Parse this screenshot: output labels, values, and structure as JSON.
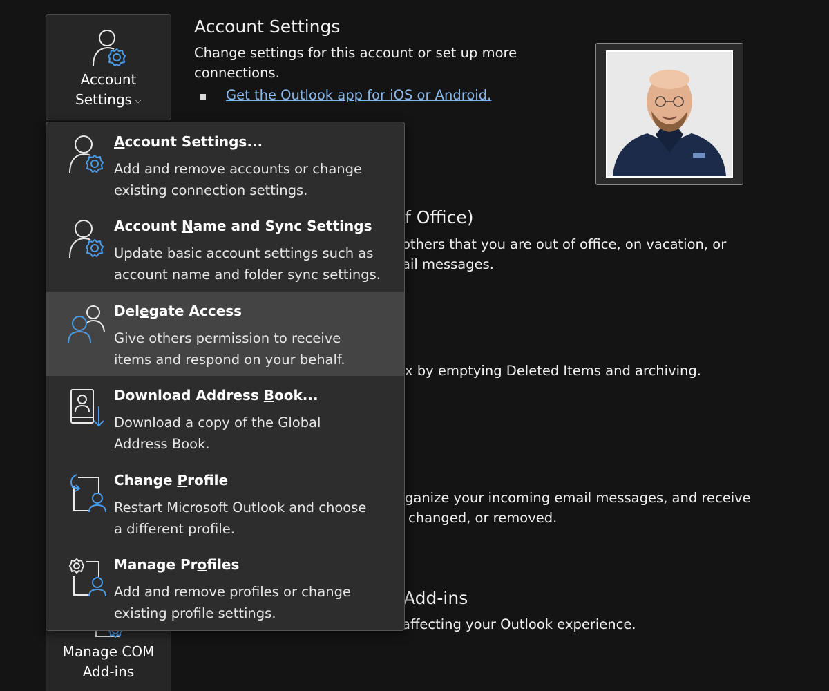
{
  "ribbon": {
    "account_settings_button": {
      "line1": "Account",
      "line2": "Settings",
      "icon": "user-gear-icon"
    },
    "manage_com_button": {
      "line1": "Manage COM",
      "line2": "Add-ins",
      "icon": "addin-gear-icon"
    }
  },
  "sections": {
    "account_settings": {
      "title": "Account Settings",
      "desc_line1": "Change settings for this account or set up more",
      "desc_line2": "connections.",
      "link": "Get the Outlook app for iOS or Android."
    },
    "automatic_replies": {
      "title_fragment": "f Office)",
      "desc_line1": "others that you are out of office, on vacation, or",
      "desc_line2": "ail messages."
    },
    "mailbox_settings": {
      "desc_line1": "x by emptying Deleted Items and archiving."
    },
    "rules_alerts": {
      "desc_line1": "ganize your incoming email messages, and receive",
      "desc_line2": "changed, or removed."
    },
    "com_addins": {
      "title_fragment": "Add-ins",
      "desc_line1": "affecting your Outlook experience."
    }
  },
  "dropdown": {
    "items": [
      {
        "icon": "user-gear-icon",
        "title_pre": "",
        "title_key": "A",
        "title_post": "ccount Settings...",
        "desc_line1": "Add and remove accounts or change",
        "desc_line2": "existing connection settings."
      },
      {
        "icon": "user-sync-gear-icon",
        "title_pre": "Account ",
        "title_key": "N",
        "title_post": "ame and Sync Settings",
        "desc_line1": "Update basic account settings such as",
        "desc_line2": "account name and folder sync settings."
      },
      {
        "icon": "people-icon",
        "title_pre": "Del",
        "title_key": "e",
        "title_post": "gate Access",
        "desc_line1": "Give others permission to receive",
        "desc_line2": "items and respond on your behalf."
      },
      {
        "icon": "address-book-download-icon",
        "title_pre": "Download Address ",
        "title_key": "B",
        "title_post": "ook...",
        "desc_line1": "Download a copy of the Global",
        "desc_line2": "Address Book."
      },
      {
        "icon": "profile-switch-icon",
        "title_pre": "Change ",
        "title_key": "P",
        "title_post": "rofile",
        "desc_line1": "Restart Microsoft Outlook and choose",
        "desc_line2": "a different profile."
      },
      {
        "icon": "profile-gear-icon",
        "title_pre": "Manage Pr",
        "title_key": "o",
        "title_post": "files",
        "desc_line1": "Add and remove profiles or change",
        "desc_line2": "existing profile settings."
      }
    ]
  },
  "colors": {
    "background": "#141414",
    "menu_bg": "#2d2d2d",
    "menu_hover": "#444444",
    "accent_blue": "#4a9be8",
    "link": "#89b7e8"
  }
}
